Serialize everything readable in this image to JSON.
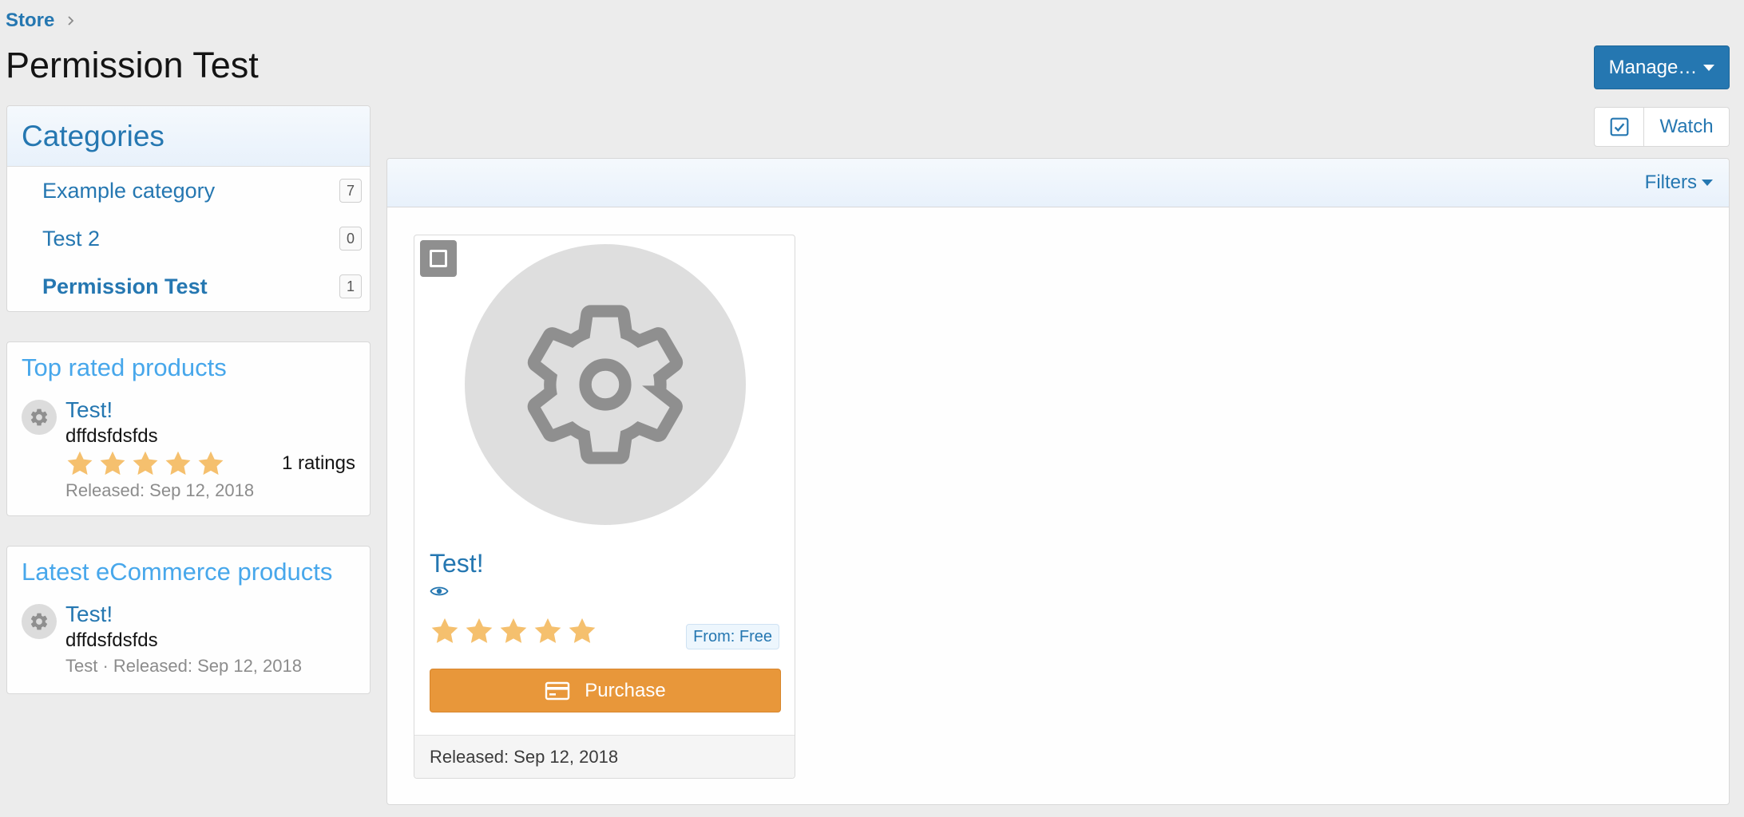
{
  "breadcrumb": {
    "store": "Store"
  },
  "page": {
    "title": "Permission Test",
    "manage_label": "Manage…"
  },
  "categories": {
    "heading": "Categories",
    "items": [
      {
        "label": "Example category",
        "count": "7"
      },
      {
        "label": "Test 2",
        "count": "0"
      },
      {
        "label": "Permission Test",
        "count": "1",
        "active": true
      }
    ]
  },
  "top_rated": {
    "heading": "Top rated products",
    "product": {
      "name": "Test!",
      "tagline": "dffdsfdsfds",
      "rating": 5,
      "ratings_text": "1 ratings",
      "released": "Released: Sep 12, 2018"
    }
  },
  "latest": {
    "heading": "Latest eCommerce products",
    "product": {
      "name": "Test!",
      "tagline": "dffdsfdsfds",
      "meta": "Test · Released: Sep 12, 2018"
    }
  },
  "watch": {
    "label": "Watch"
  },
  "filters": {
    "label": "Filters"
  },
  "card": {
    "title": "Test!",
    "rating": 5,
    "price": "From: Free",
    "purchase_label": "Purchase",
    "released": "Released: Sep 12, 2018"
  },
  "colors": {
    "accent": "#2577b1",
    "star": "#f5c06e",
    "purchase": "#e8973a",
    "sidebar_heading": "#47a7eb"
  },
  "icons": {
    "breadcrumb_sep": "chevron-right-icon",
    "manage_caret": "caret-down-icon",
    "watch_check": "checkbox-checked-icon",
    "product_placeholder": "gear-icon",
    "view": "eye-icon",
    "purchase": "credit-card-icon"
  }
}
